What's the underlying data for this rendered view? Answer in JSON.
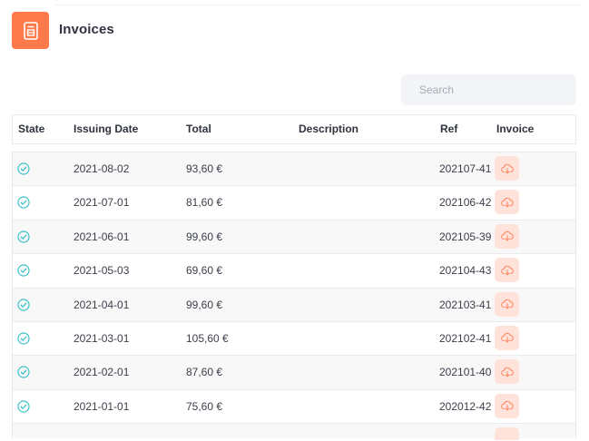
{
  "header": {
    "title": "Invoices",
    "icon": "invoice-document-icon",
    "accent_color": "#ff7a4b"
  },
  "search": {
    "placeholder": "Search",
    "value": ""
  },
  "table": {
    "columns": [
      "State",
      "Issuing Date",
      "Total",
      "Description",
      "Ref",
      "Invoice"
    ],
    "rows": [
      {
        "state": "paid-check-icon",
        "date": "2021-08-02",
        "total": "93,60 €",
        "description": "",
        "ref": "202107-41",
        "invoice": "download-cloud-icon"
      },
      {
        "state": "paid-check-icon",
        "date": "2021-07-01",
        "total": "81,60 €",
        "description": "",
        "ref": "202106-42",
        "invoice": "download-cloud-icon"
      },
      {
        "state": "paid-check-icon",
        "date": "2021-06-01",
        "total": "99,60 €",
        "description": "",
        "ref": "202105-39",
        "invoice": "download-cloud-icon"
      },
      {
        "state": "paid-check-icon",
        "date": "2021-05-03",
        "total": "69,60 €",
        "description": "",
        "ref": "202104-43",
        "invoice": "download-cloud-icon"
      },
      {
        "state": "paid-check-icon",
        "date": "2021-04-01",
        "total": "99,60 €",
        "description": "",
        "ref": "202103-41",
        "invoice": "download-cloud-icon"
      },
      {
        "state": "paid-check-icon",
        "date": "2021-03-01",
        "total": "105,60 €",
        "description": "",
        "ref": "202102-41",
        "invoice": "download-cloud-icon"
      },
      {
        "state": "paid-check-icon",
        "date": "2021-02-01",
        "total": "87,60 €",
        "description": "",
        "ref": "202101-40",
        "invoice": "download-cloud-icon"
      },
      {
        "state": "paid-check-icon",
        "date": "2021-01-01",
        "total": "75,60 €",
        "description": "",
        "ref": "202012-42",
        "invoice": "download-cloud-icon"
      }
    ]
  },
  "colors": {
    "state_check": "#3cc2c8",
    "download_bg": "#ffe3da",
    "download_icon": "#ff8a66"
  }
}
